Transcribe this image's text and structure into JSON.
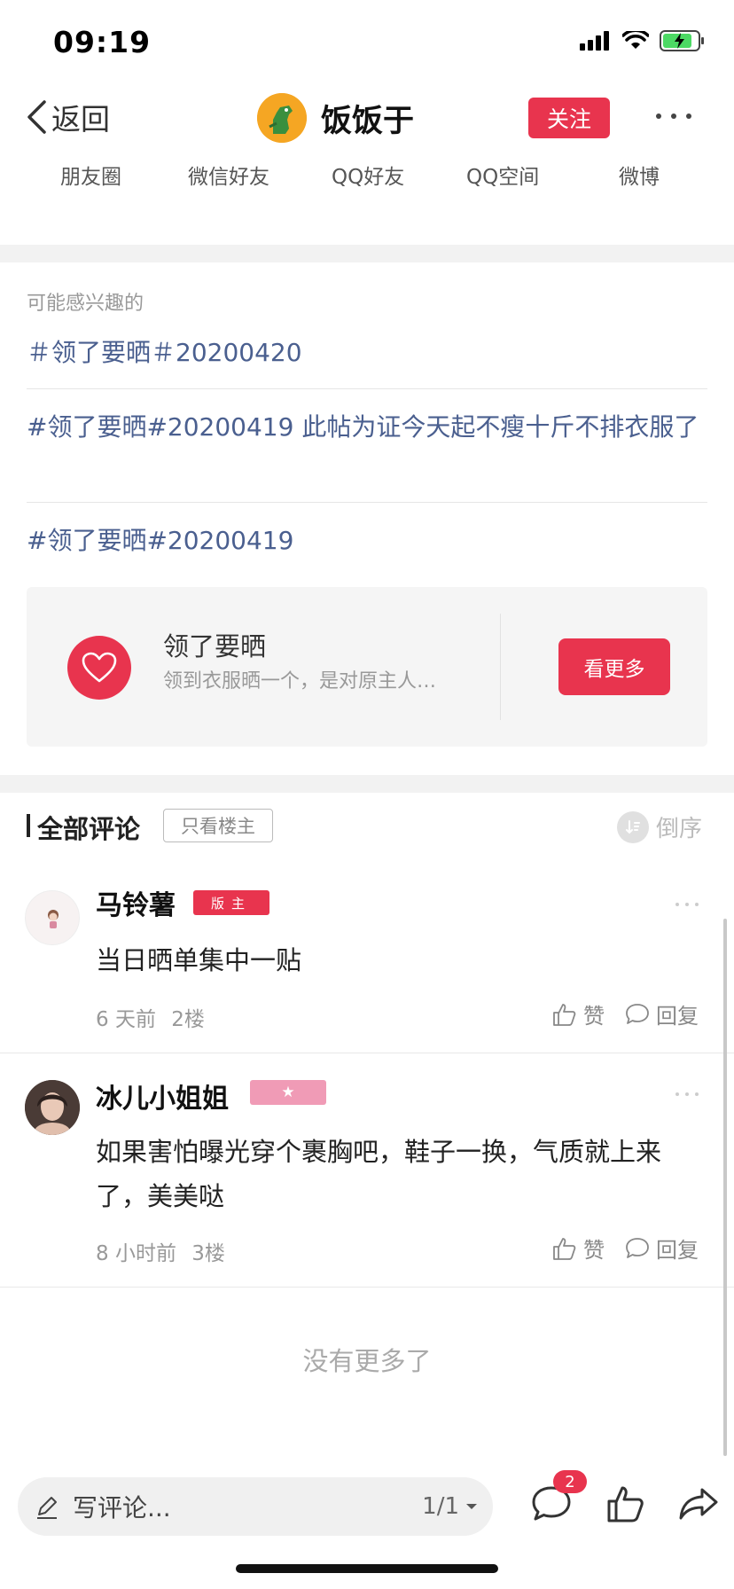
{
  "status_bar": {
    "time": "09:19"
  },
  "nav": {
    "back_label": "返回",
    "username": "饭饭于",
    "follow_label": "关注"
  },
  "share": {
    "items": [
      "朋友圈",
      "微信好友",
      "QQ好友",
      "QQ空间",
      "微博"
    ]
  },
  "recommend": {
    "title": "可能感兴趣的",
    "topics": [
      "＃领了要晒＃20200420",
      "#领了要晒#20200419 此帖为证今天起不瘦十斤不排衣服了",
      "#领了要晒#20200419"
    ]
  },
  "circle": {
    "name": "领了要晒",
    "description": "领到衣服晒一个，是对原主人…",
    "see_more_label": "看更多"
  },
  "comments_header": {
    "title": "全部评论",
    "only_op_label": "只看楼主",
    "sort_label": "倒序"
  },
  "comments": [
    {
      "name": "马铃薯",
      "badge": "版主",
      "text": "当日晒单集中一贴",
      "time": "6 天前",
      "floor": "2楼",
      "like_label": "赞",
      "reply_label": "回复"
    },
    {
      "name": "冰儿小姐姐",
      "badge": "★",
      "text": "如果害怕曝光穿个裹胸吧，鞋子一换，气质就上来了，美美哒",
      "time": "8 小时前",
      "floor": "3楼",
      "like_label": "赞",
      "reply_label": "回复"
    }
  ],
  "no_more_label": "没有更多了",
  "bottom_bar": {
    "input_placeholder": "写评论...",
    "page_indicator": "1/1",
    "comment_count": "2"
  },
  "colors": {
    "accent": "#e8344e",
    "topic_link": "#4a5f8f",
    "star_badge": "#f09bb6"
  }
}
